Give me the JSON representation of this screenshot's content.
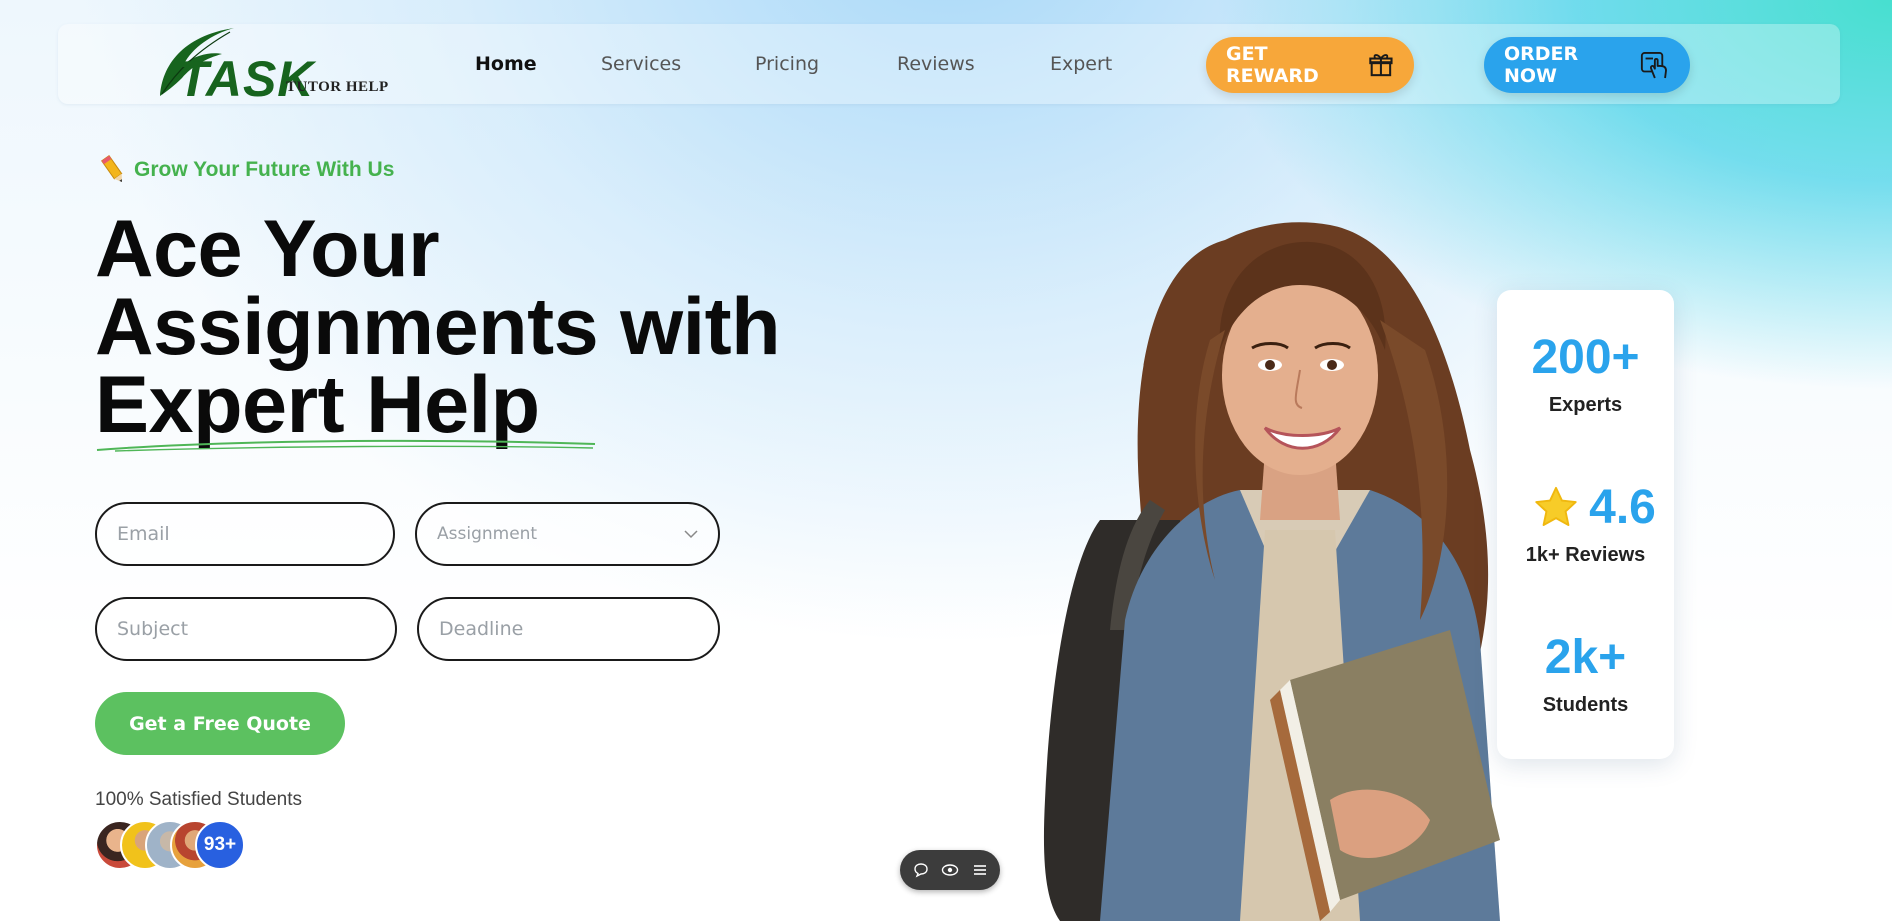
{
  "brand": {
    "logo_main": "TASK",
    "logo_sub": "TUTOR HELP"
  },
  "nav": [
    {
      "label": "Home",
      "active": true
    },
    {
      "label": "Services",
      "active": false
    },
    {
      "label": "Pricing",
      "active": false
    },
    {
      "label": "Reviews",
      "active": false
    },
    {
      "label": "Expert",
      "active": false
    }
  ],
  "header_buttons": {
    "reward": {
      "label": "GET REWARD",
      "icon": "gift-icon",
      "color": "#f7a73a"
    },
    "order": {
      "label": "ORDER NOW",
      "icon": "tap-hand-icon",
      "color": "#2aa3ec"
    }
  },
  "hero": {
    "tagline": "Grow Your Future With Us",
    "tagline_icon": "pencil-icon",
    "title_lines": [
      "Ace Your",
      "Assignments with",
      "Expert Help"
    ]
  },
  "form": {
    "email_placeholder": "Email",
    "assignment_placeholder": "Assignment",
    "subject_placeholder": "Subject",
    "deadline_placeholder": "Deadline",
    "submit_label": "Get a Free Quote"
  },
  "social_proof": {
    "label": "100% Satisfied Students",
    "count_badge": "93+"
  },
  "stats": [
    {
      "value": "200+",
      "label": "Experts"
    },
    {
      "value": "4.6",
      "label": "1k+ Reviews",
      "icon": "star-icon"
    },
    {
      "value": "2k+",
      "label": "Students"
    }
  ],
  "toolbar_icons": [
    "chat-icon",
    "eye-icon",
    "menu-icon"
  ],
  "colors": {
    "green": "#5cc160",
    "blue": "#2aa3ec",
    "orange": "#f7a73a",
    "logo_green": "#17641e"
  }
}
